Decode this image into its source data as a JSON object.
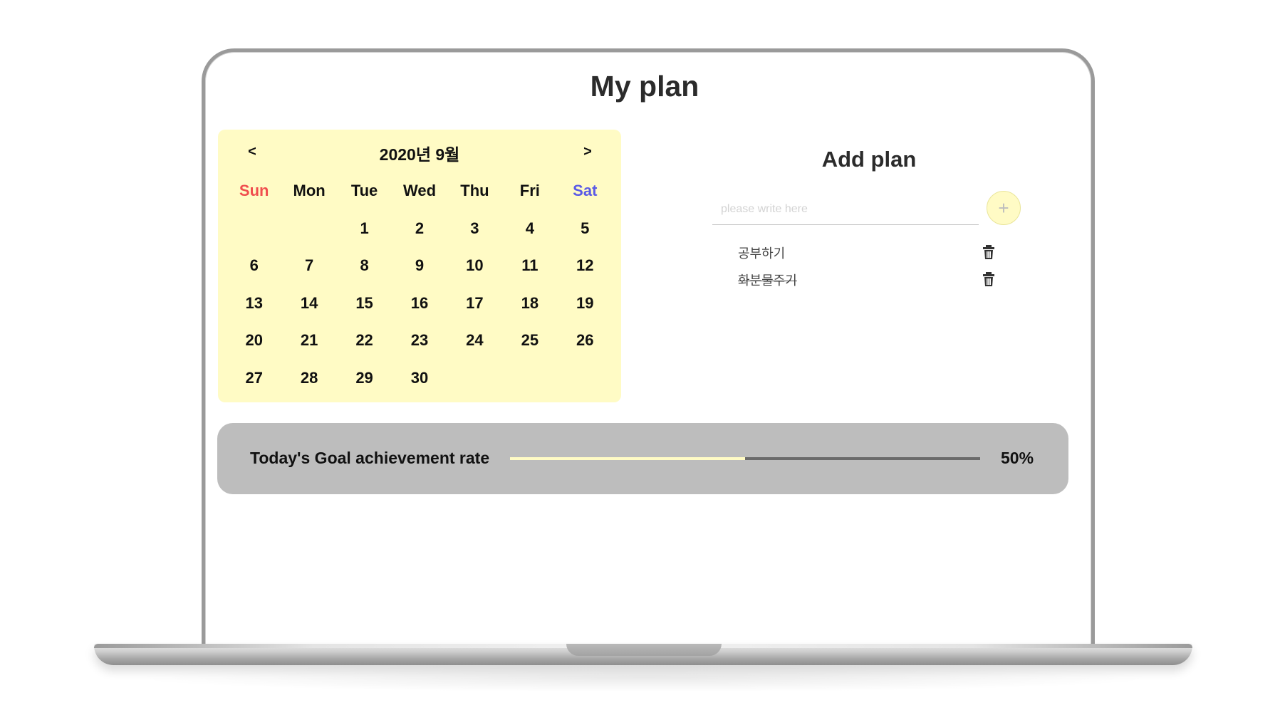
{
  "app": {
    "title": "My plan"
  },
  "calendar": {
    "prev_label": "<",
    "next_label": ">",
    "month_label": "2020년 9월",
    "weekdays": [
      "Sun",
      "Mon",
      "Tue",
      "Wed",
      "Thu",
      "Fri",
      "Sat"
    ],
    "leading_blanks": 2,
    "days": [
      "1",
      "2",
      "3",
      "4",
      "5",
      "6",
      "7",
      "8",
      "9",
      "10",
      "11",
      "12",
      "13",
      "14",
      "15",
      "16",
      "17",
      "18",
      "19",
      "20",
      "21",
      "22",
      "23",
      "24",
      "25",
      "26",
      "27",
      "28",
      "29",
      "30"
    ]
  },
  "plan": {
    "title": "Add plan",
    "input_placeholder": "please write here",
    "input_value": "",
    "add_label": "+",
    "items": [
      {
        "text": "공부하기",
        "done": false
      },
      {
        "text": "화분물주기",
        "done": true
      }
    ]
  },
  "progress": {
    "label": "Today's Goal achievement rate",
    "value_text": "50%",
    "fraction": 0.5
  },
  "colors": {
    "calendar_bg": "#fffbc5",
    "sunday": "#f04e4e",
    "saturday": "#5a5ae6",
    "panel_bg": "#bdbdbd",
    "progress_fill": "#fffbc5",
    "progress_track": "#6b6b6b"
  }
}
